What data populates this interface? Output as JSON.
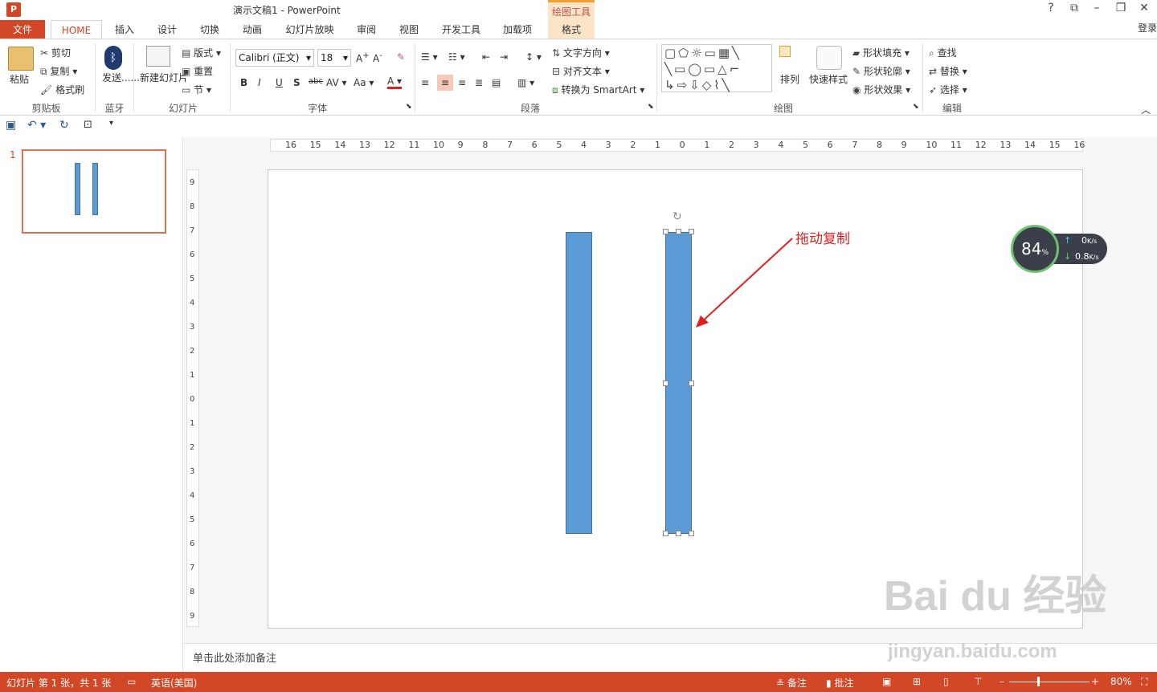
{
  "app": {
    "icon_letter": "P",
    "title": "演示文稿1 - PowerPoint",
    "context_group": "绘图工具",
    "login": "登录",
    "help": "?",
    "window_controls": [
      "restore-ribbon-icon",
      "minimize-icon",
      "maximize-icon",
      "close-icon"
    ]
  },
  "tabs": {
    "file": "文件",
    "items": [
      "HOME",
      "插入",
      "设计",
      "切换",
      "动画",
      "幻灯片放映",
      "审阅",
      "视图",
      "开发工具",
      "加载项",
      "格式"
    ],
    "active": "HOME"
  },
  "ribbon": {
    "clipboard": {
      "paste": "粘贴",
      "cut": "剪切",
      "copy": "复制",
      "format_painter": "格式刷",
      "label": "剪贴板"
    },
    "bluetooth": {
      "send": "发送......",
      "label": "蓝牙"
    },
    "slides": {
      "new_slide": "新建幻灯片",
      "layout": "版式",
      "reset": "重置",
      "section": "节",
      "label": "幻灯片"
    },
    "font": {
      "font_name": "Calibri (正文)",
      "font_size": "18",
      "label": "字体"
    },
    "paragraph": {
      "text_direction": "文字方向",
      "align_text": "对齐文本",
      "convert_smartart": "转换为 SmartArt",
      "label": "段落"
    },
    "drawing": {
      "arrange": "排列",
      "quick_styles": "快速样式",
      "shape_fill": "形状填充",
      "shape_outline": "形状轮廓",
      "shape_effects": "形状效果",
      "label": "绘图"
    },
    "editing": {
      "find": "查找",
      "replace": "替换",
      "select": "选择",
      "label": "编辑"
    }
  },
  "ruler": {
    "h_ticks": [
      "16",
      "15",
      "14",
      "13",
      "12",
      "11",
      "10",
      "9",
      "8",
      "7",
      "6",
      "5",
      "4",
      "3",
      "2",
      "1",
      "0",
      "1",
      "2",
      "3",
      "4",
      "5",
      "6",
      "7",
      "8",
      "9",
      "10",
      "11",
      "12",
      "13",
      "14",
      "15",
      "16"
    ],
    "v_ticks": [
      "9",
      "8",
      "7",
      "6",
      "5",
      "4",
      "3",
      "2",
      "1",
      "0",
      "1",
      "2",
      "3",
      "4",
      "5",
      "6",
      "7",
      "8",
      "9"
    ]
  },
  "thumbnail": {
    "slide_number": "1"
  },
  "slide": {
    "annotation": "拖动复制"
  },
  "notes": {
    "placeholder": "单击此处添加备注"
  },
  "status": {
    "slide_info": "幻灯片 第 1 张，共 1 张",
    "language": "英语(美国)",
    "notes": "备注",
    "comments": "批注",
    "zoom": "80%"
  },
  "net_widget": {
    "percent": "84",
    "percent_sign": "%",
    "up": "0",
    "down": "0.8",
    "unit": "K/s"
  },
  "watermark": {
    "brand": "Bai du 经验",
    "url": "jingyan.baidu.com"
  }
}
